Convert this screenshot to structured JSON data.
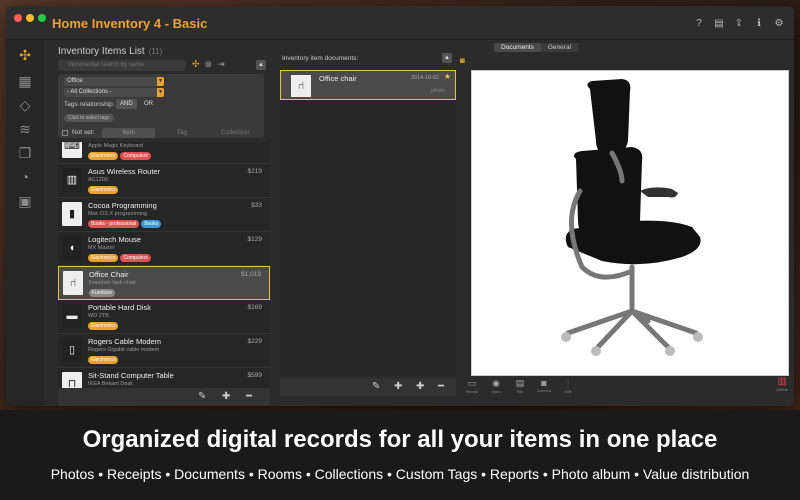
{
  "window": {
    "title": "Home Inventory 4 - Basic",
    "toolbar_icons": [
      "help-icon",
      "document-icon",
      "share-icon",
      "info-icon",
      "gear-icon"
    ]
  },
  "sidebar": {
    "icons": [
      "inventory-icon",
      "rooms-icon",
      "tags-icon",
      "collections-icon",
      "documents-icon",
      "distribution-icon",
      "reports-icon"
    ]
  },
  "list_panel": {
    "title": "Inventory Items List",
    "count": "(11)",
    "search_placeholder": "Incremental search by name",
    "filter": {
      "category": "Office",
      "collection": "- All Collections -",
      "tags_relationship_label": "Tags relationship:",
      "and_label": "AND",
      "or_label": "OR",
      "click_tags_label": "Click to select tags"
    },
    "not_set": {
      "label": "Not set:",
      "options": [
        "Item",
        "Tag",
        "Collection"
      ]
    },
    "items": [
      {
        "name": "",
        "sub": "Apple Magic Keyboard",
        "price": "",
        "tags": [
          {
            "label": "Electronics",
            "color": "#e8a030"
          },
          {
            "label": "Computers",
            "color": "#e05050"
          }
        ],
        "glyph": "⌨"
      },
      {
        "name": "Asus Wireless Router",
        "sub": "AC1200",
        "price": "$219",
        "tags": [
          {
            "label": "Electronics",
            "color": "#e8a030"
          }
        ],
        "glyph": "▥"
      },
      {
        "name": "Cocoa Programming",
        "sub": "Mac OS X programming",
        "price": "$33",
        "tags": [
          {
            "label": "Books - professional",
            "color": "#e05050"
          },
          {
            "label": "Books",
            "color": "#3a9ad9"
          }
        ],
        "glyph": "▮"
      },
      {
        "name": "Logitech Mouse",
        "sub": "MX Master",
        "price": "$129",
        "tags": [
          {
            "label": "Electronics",
            "color": "#e8a030"
          },
          {
            "label": "Computers",
            "color": "#e05050"
          }
        ],
        "glyph": "◖"
      },
      {
        "name": "Office Chair",
        "sub": "Freedom task chair",
        "price": "$1,019",
        "tags": [
          {
            "label": "Furniture",
            "color": "#888888"
          }
        ],
        "glyph": "⑁"
      },
      {
        "name": "Portable Hard Disk",
        "sub": "WD 2TB",
        "price": "$169",
        "tags": [
          {
            "label": "Electronics",
            "color": "#e8a030"
          }
        ],
        "glyph": "▬"
      },
      {
        "name": "Rogers Cable Modem",
        "sub": "Rogers Gigabit cable modem",
        "price": "$229",
        "tags": [
          {
            "label": "Electronics",
            "color": "#e8a030"
          }
        ],
        "glyph": "▯"
      },
      {
        "name": "Sit-Stand Computer Table",
        "sub": "IKEA Bekant Desk",
        "price": "$599",
        "tags": [],
        "glyph": "⊓"
      }
    ]
  },
  "doc_panel": {
    "title": "Inventory item documents:",
    "doc": {
      "name": "Office chair",
      "date": "2014-10-02",
      "type": "photo"
    }
  },
  "viewer": {
    "tabs": [
      "Documents",
      "General"
    ],
    "tools": [
      {
        "icon": "reveal-icon",
        "label": "Reveal",
        "glyph": "▭"
      },
      {
        "icon": "open-icon",
        "label": "Open",
        "glyph": "◉"
      },
      {
        "icon": "file-icon",
        "label": "File",
        "glyph": "▤"
      },
      {
        "icon": "camera-icon",
        "label": "Camera",
        "glyph": "◙"
      },
      {
        "icon": "edit-icon",
        "label": "Edit",
        "glyph": "⫶"
      }
    ],
    "delete_label": "Delete"
  },
  "caption": {
    "headline": "Organized digital records for all your items in one place",
    "features": "Photos • Receipts • Documents • Rooms • Collections • Custom Tags • Reports • Photo album • Value distribution"
  }
}
